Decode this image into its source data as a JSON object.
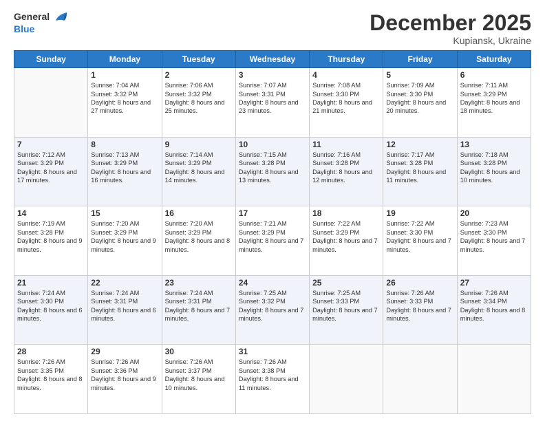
{
  "logo": {
    "general": "General",
    "blue": "Blue"
  },
  "header": {
    "month": "December 2025",
    "location": "Kupiansk, Ukraine"
  },
  "days_of_week": [
    "Sunday",
    "Monday",
    "Tuesday",
    "Wednesday",
    "Thursday",
    "Friday",
    "Saturday"
  ],
  "weeks": [
    [
      {
        "day": "",
        "sunrise": "",
        "sunset": "",
        "daylight": ""
      },
      {
        "day": "1",
        "sunrise": "Sunrise: 7:04 AM",
        "sunset": "Sunset: 3:32 PM",
        "daylight": "Daylight: 8 hours and 27 minutes."
      },
      {
        "day": "2",
        "sunrise": "Sunrise: 7:06 AM",
        "sunset": "Sunset: 3:32 PM",
        "daylight": "Daylight: 8 hours and 25 minutes."
      },
      {
        "day": "3",
        "sunrise": "Sunrise: 7:07 AM",
        "sunset": "Sunset: 3:31 PM",
        "daylight": "Daylight: 8 hours and 23 minutes."
      },
      {
        "day": "4",
        "sunrise": "Sunrise: 7:08 AM",
        "sunset": "Sunset: 3:30 PM",
        "daylight": "Daylight: 8 hours and 21 minutes."
      },
      {
        "day": "5",
        "sunrise": "Sunrise: 7:09 AM",
        "sunset": "Sunset: 3:30 PM",
        "daylight": "Daylight: 8 hours and 20 minutes."
      },
      {
        "day": "6",
        "sunrise": "Sunrise: 7:11 AM",
        "sunset": "Sunset: 3:29 PM",
        "daylight": "Daylight: 8 hours and 18 minutes."
      }
    ],
    [
      {
        "day": "7",
        "sunrise": "Sunrise: 7:12 AM",
        "sunset": "Sunset: 3:29 PM",
        "daylight": "Daylight: 8 hours and 17 minutes."
      },
      {
        "day": "8",
        "sunrise": "Sunrise: 7:13 AM",
        "sunset": "Sunset: 3:29 PM",
        "daylight": "Daylight: 8 hours and 16 minutes."
      },
      {
        "day": "9",
        "sunrise": "Sunrise: 7:14 AM",
        "sunset": "Sunset: 3:29 PM",
        "daylight": "Daylight: 8 hours and 14 minutes."
      },
      {
        "day": "10",
        "sunrise": "Sunrise: 7:15 AM",
        "sunset": "Sunset: 3:28 PM",
        "daylight": "Daylight: 8 hours and 13 minutes."
      },
      {
        "day": "11",
        "sunrise": "Sunrise: 7:16 AM",
        "sunset": "Sunset: 3:28 PM",
        "daylight": "Daylight: 8 hours and 12 minutes."
      },
      {
        "day": "12",
        "sunrise": "Sunrise: 7:17 AM",
        "sunset": "Sunset: 3:28 PM",
        "daylight": "Daylight: 8 hours and 11 minutes."
      },
      {
        "day": "13",
        "sunrise": "Sunrise: 7:18 AM",
        "sunset": "Sunset: 3:28 PM",
        "daylight": "Daylight: 8 hours and 10 minutes."
      }
    ],
    [
      {
        "day": "14",
        "sunrise": "Sunrise: 7:19 AM",
        "sunset": "Sunset: 3:28 PM",
        "daylight": "Daylight: 8 hours and 9 minutes."
      },
      {
        "day": "15",
        "sunrise": "Sunrise: 7:20 AM",
        "sunset": "Sunset: 3:29 PM",
        "daylight": "Daylight: 8 hours and 9 minutes."
      },
      {
        "day": "16",
        "sunrise": "Sunrise: 7:20 AM",
        "sunset": "Sunset: 3:29 PM",
        "daylight": "Daylight: 8 hours and 8 minutes."
      },
      {
        "day": "17",
        "sunrise": "Sunrise: 7:21 AM",
        "sunset": "Sunset: 3:29 PM",
        "daylight": "Daylight: 8 hours and 7 minutes."
      },
      {
        "day": "18",
        "sunrise": "Sunrise: 7:22 AM",
        "sunset": "Sunset: 3:29 PM",
        "daylight": "Daylight: 8 hours and 7 minutes."
      },
      {
        "day": "19",
        "sunrise": "Sunrise: 7:22 AM",
        "sunset": "Sunset: 3:30 PM",
        "daylight": "Daylight: 8 hours and 7 minutes."
      },
      {
        "day": "20",
        "sunrise": "Sunrise: 7:23 AM",
        "sunset": "Sunset: 3:30 PM",
        "daylight": "Daylight: 8 hours and 7 minutes."
      }
    ],
    [
      {
        "day": "21",
        "sunrise": "Sunrise: 7:24 AM",
        "sunset": "Sunset: 3:30 PM",
        "daylight": "Daylight: 8 hours and 6 minutes."
      },
      {
        "day": "22",
        "sunrise": "Sunrise: 7:24 AM",
        "sunset": "Sunset: 3:31 PM",
        "daylight": "Daylight: 8 hours and 6 minutes."
      },
      {
        "day": "23",
        "sunrise": "Sunrise: 7:24 AM",
        "sunset": "Sunset: 3:31 PM",
        "daylight": "Daylight: 8 hours and 7 minutes."
      },
      {
        "day": "24",
        "sunrise": "Sunrise: 7:25 AM",
        "sunset": "Sunset: 3:32 PM",
        "daylight": "Daylight: 8 hours and 7 minutes."
      },
      {
        "day": "25",
        "sunrise": "Sunrise: 7:25 AM",
        "sunset": "Sunset: 3:33 PM",
        "daylight": "Daylight: 8 hours and 7 minutes."
      },
      {
        "day": "26",
        "sunrise": "Sunrise: 7:26 AM",
        "sunset": "Sunset: 3:33 PM",
        "daylight": "Daylight: 8 hours and 7 minutes."
      },
      {
        "day": "27",
        "sunrise": "Sunrise: 7:26 AM",
        "sunset": "Sunset: 3:34 PM",
        "daylight": "Daylight: 8 hours and 8 minutes."
      }
    ],
    [
      {
        "day": "28",
        "sunrise": "Sunrise: 7:26 AM",
        "sunset": "Sunset: 3:35 PM",
        "daylight": "Daylight: 8 hours and 8 minutes."
      },
      {
        "day": "29",
        "sunrise": "Sunrise: 7:26 AM",
        "sunset": "Sunset: 3:36 PM",
        "daylight": "Daylight: 8 hours and 9 minutes."
      },
      {
        "day": "30",
        "sunrise": "Sunrise: 7:26 AM",
        "sunset": "Sunset: 3:37 PM",
        "daylight": "Daylight: 8 hours and 10 minutes."
      },
      {
        "day": "31",
        "sunrise": "Sunrise: 7:26 AM",
        "sunset": "Sunset: 3:38 PM",
        "daylight": "Daylight: 8 hours and 11 minutes."
      },
      {
        "day": "",
        "sunrise": "",
        "sunset": "",
        "daylight": ""
      },
      {
        "day": "",
        "sunrise": "",
        "sunset": "",
        "daylight": ""
      },
      {
        "day": "",
        "sunrise": "",
        "sunset": "",
        "daylight": ""
      }
    ]
  ]
}
